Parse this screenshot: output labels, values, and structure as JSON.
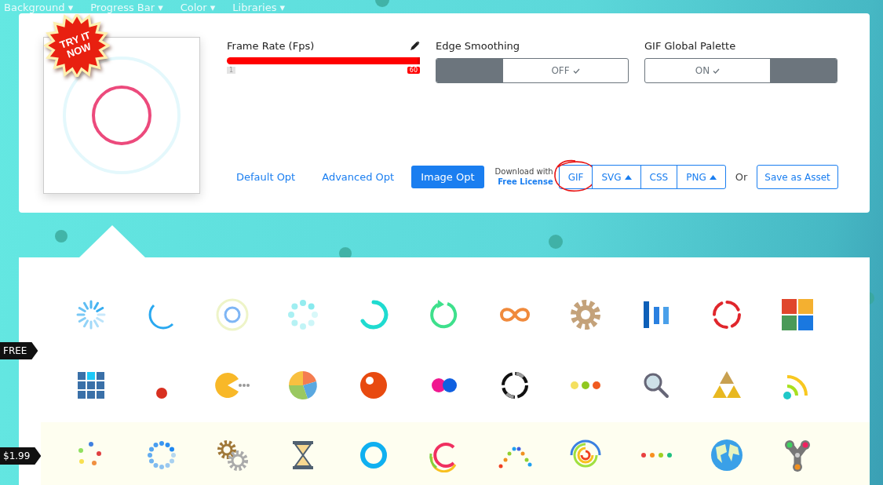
{
  "nav": [
    {
      "label": "Background",
      "caret": "▾"
    },
    {
      "label": "Progress Bar",
      "caret": "▾"
    },
    {
      "label": "Color",
      "caret": "▾"
    },
    {
      "label": "Libraries",
      "caret": "▾"
    }
  ],
  "promo_badge": {
    "line1": "TRY IT",
    "line2": "NOW"
  },
  "frame_rate": {
    "label": "Frame Rate (Fps)",
    "level": 1,
    "min": "1",
    "max": "60"
  },
  "toggles": [
    {
      "label": "Edge Smoothing",
      "value": "OFF",
      "on": false
    },
    {
      "label": "GIF Global Palette",
      "value": "ON",
      "on": true
    }
  ],
  "option_tabs": [
    {
      "label": "Default Opt",
      "selected": false
    },
    {
      "label": "Advanced Opt",
      "selected": false
    },
    {
      "label": "Image Opt",
      "selected": true
    }
  ],
  "download": {
    "line1": "Download with",
    "link": "Free License"
  },
  "formats": [
    {
      "label": "GIF",
      "has_menu": false,
      "circled": true
    },
    {
      "label": "SVG",
      "has_menu": true,
      "circled": false
    },
    {
      "label": "CSS",
      "has_menu": false,
      "circled": false
    },
    {
      "label": "PNG",
      "has_menu": true,
      "circled": false
    }
  ],
  "or_text": "Or",
  "save_button": "Save as Asset",
  "loader_rows": [
    {
      "highlighted": false
    },
    {
      "highlighted": false
    },
    {
      "highlighted": true
    }
  ],
  "price_tags": [
    {
      "label": "FREE"
    },
    {
      "label": "$1.99"
    }
  ]
}
